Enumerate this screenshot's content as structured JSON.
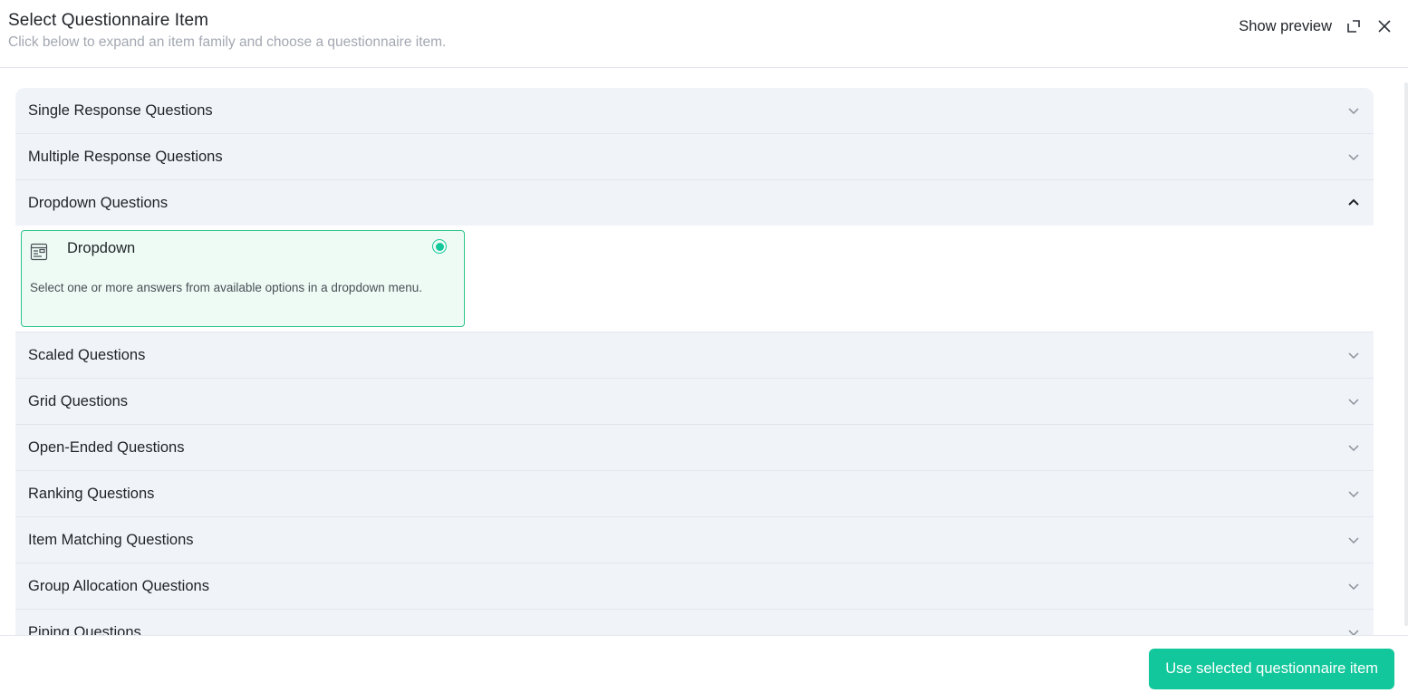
{
  "header": {
    "title": "Select Questionnaire Item",
    "subtitle": "Click below to expand an item family and choose a questionnaire item.",
    "show_preview_label": "Show preview",
    "expand_icon": "expand-icon",
    "close_icon": "close-icon"
  },
  "families": [
    {
      "label": "Single Response Questions",
      "expanded": false
    },
    {
      "label": "Multiple Response Questions",
      "expanded": false
    },
    {
      "label": "Dropdown Questions",
      "expanded": true
    },
    {
      "label": "Scaled Questions",
      "expanded": false
    },
    {
      "label": "Grid Questions",
      "expanded": false
    },
    {
      "label": "Open-Ended Questions",
      "expanded": false
    },
    {
      "label": "Ranking Questions",
      "expanded": false
    },
    {
      "label": "Item Matching Questions",
      "expanded": false
    },
    {
      "label": "Group Allocation Questions",
      "expanded": false
    },
    {
      "label": "Piping Questions",
      "expanded": false
    }
  ],
  "selected_item": {
    "name": "Dropdown",
    "description": "Select one or more answers from available options in a dropdown menu.",
    "icon": "dropdown-form-icon",
    "selected": true
  },
  "footer": {
    "use_button_label": "Use selected questionnaire item"
  },
  "colors": {
    "accent": "#12c79b",
    "card_bg": "#eefbf4",
    "card_border": "#2cc58a",
    "accordion_bg": "#f0f3f8"
  }
}
